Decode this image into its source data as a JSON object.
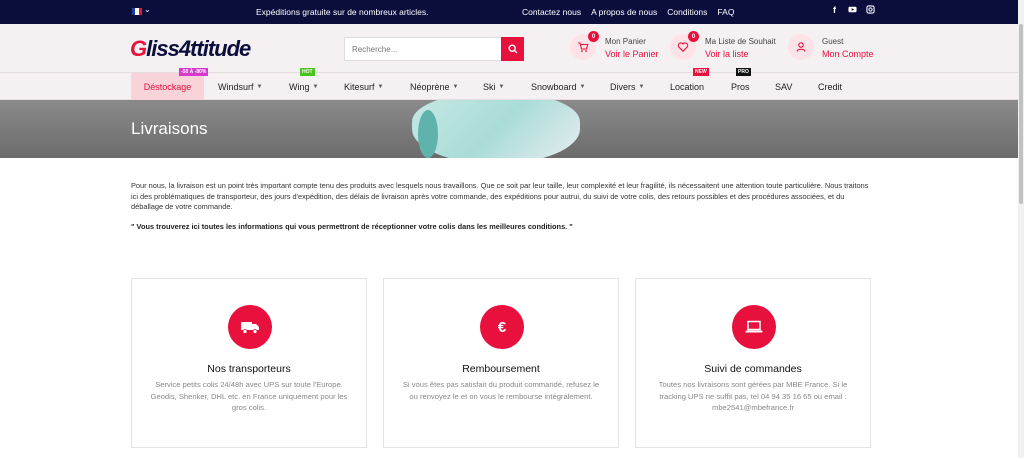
{
  "topbar": {
    "promo": "Expéditions gratuite sur de nombreux articles.",
    "links": [
      "Contactez nous",
      "A propos de nous",
      "Conditions",
      "FAQ"
    ],
    "social_icons": [
      "facebook-icon",
      "youtube-icon",
      "instagram-icon"
    ],
    "colors": {
      "bg": "#0b0e3d"
    }
  },
  "header": {
    "logo": "Gliss4ttitude",
    "search_placeholder": "Recherche...",
    "cart": {
      "title": "Mon Panier",
      "link": "Voir le Panier",
      "count": "0"
    },
    "wishlist": {
      "title": "Ma Liste de Souhait",
      "link": "Voir la liste",
      "count": "0"
    },
    "account": {
      "title": "Guest",
      "link": "Mon Compte"
    },
    "accent": "#e8103d"
  },
  "nav": {
    "items": [
      {
        "label": "Déstockage",
        "tag": "-50 À -80%"
      },
      {
        "label": "Windsurf"
      },
      {
        "label": "Wing",
        "tag": "HOT"
      },
      {
        "label": "Kitesurf"
      },
      {
        "label": "Néoprène"
      },
      {
        "label": "Ski"
      },
      {
        "label": "Snowboard"
      },
      {
        "label": "Divers"
      },
      {
        "label": "Location",
        "tag": "NEW"
      },
      {
        "label": "Pros",
        "tag": "PRO"
      },
      {
        "label": "SAV"
      },
      {
        "label": "Credit"
      }
    ]
  },
  "page": {
    "title": "Livraisons",
    "intro": "Pour nous, la livraison est un point très important compte tenu des produits avec lesquels nous travaillons. Que ce soit par leur taille, leur complexité et leur fragilité, ils nécessaitent une attention toute particulière. Nous traitons ici des problématiques de transporteur, des jours d'expédition, des délais de livraison après votre commande, des expéditions pour autrui, du suivi de votre colis, des retours possibles et des procédures associées, et du déballage de votre commande.",
    "quote": "\" Vous trouverez ici toutes les informations qui vous permettront de réceptionner votre colis dans les meilleures conditions. \""
  },
  "cards": [
    {
      "icon": "truck-icon",
      "title": "Nos transporteurs",
      "text": "Service petits colis 24/48h avec UPS sur toute l'Europe. Geodis, Shenker, DHL etc. en France uniquement pour les gros colis."
    },
    {
      "icon": "euro-icon",
      "title": "Remboursement",
      "text": "Si vous êtes pas satisfait du produit commandé, refusez le ou renvoyez le et on vous le rembourse intégralement."
    },
    {
      "icon": "laptop-icon",
      "title": "Suivi de commandes",
      "text": "Toutes nos livraisons sont gérées par MBE France. Si le tracking UPS ne suffit pas, tel 04 94 35 16 65 ou email : mbe2541@mbefrance.fr"
    }
  ]
}
